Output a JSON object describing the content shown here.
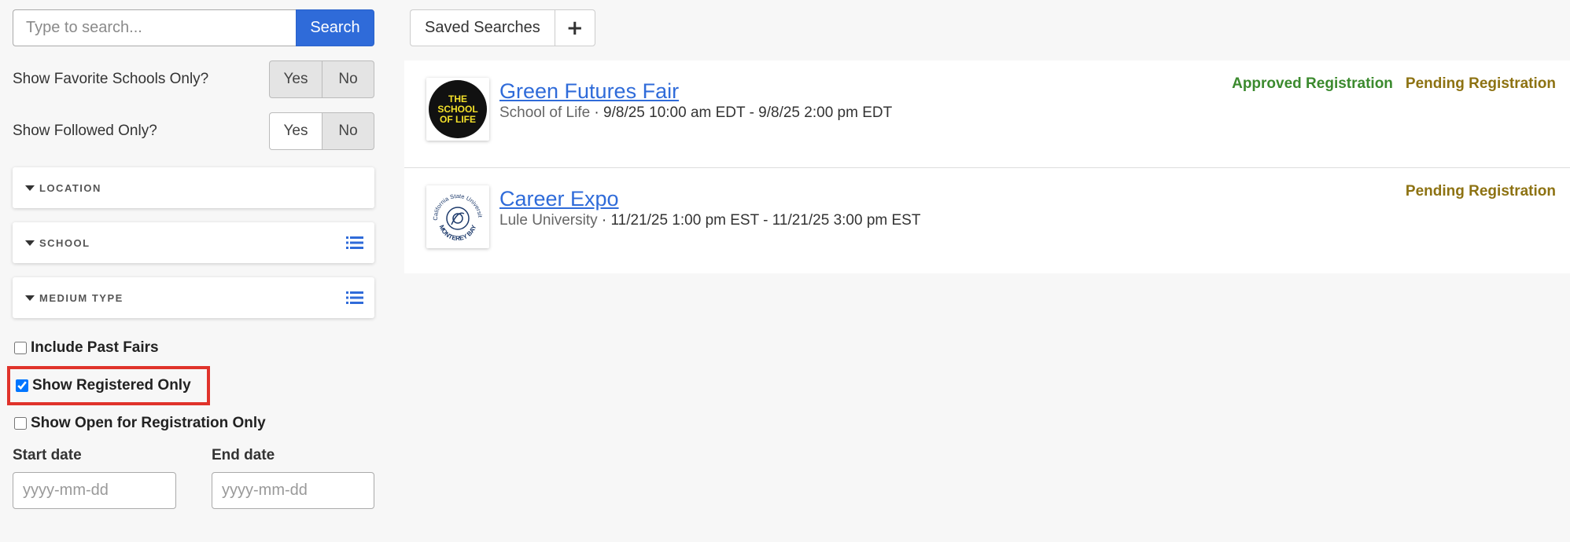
{
  "search": {
    "placeholder": "Type to search...",
    "button_label": "Search"
  },
  "filters": {
    "favorite_schools": {
      "label": "Show Favorite Schools Only?",
      "yes": "Yes",
      "no": "No",
      "selected": "No"
    },
    "followed": {
      "label": "Show Followed Only?",
      "yes": "Yes",
      "no": "No",
      "selected": "No"
    },
    "facets": [
      {
        "label": "LOCATION",
        "has_list_icon": false
      },
      {
        "label": "SCHOOL",
        "has_list_icon": true
      },
      {
        "label": "MEDIUM TYPE",
        "has_list_icon": true
      }
    ],
    "checkboxes": [
      {
        "label": "Include Past Fairs",
        "checked": false
      },
      {
        "label": "Show Registered Only",
        "checked": true
      },
      {
        "label": "Show Open for Registration Only",
        "checked": false
      }
    ],
    "start_date": {
      "label": "Start date",
      "placeholder": "yyyy-mm-dd"
    },
    "end_date": {
      "label": "End date",
      "placeholder": "yyyy-mm-dd"
    }
  },
  "saved_searches": {
    "label": "Saved Searches",
    "add_label": "+"
  },
  "results": [
    {
      "title": "Green Futures Fair",
      "school": "School of Life",
      "separator": " · ",
      "dates": "9/8/25 10:00 am EDT - 9/8/25 2:00 pm EDT",
      "logo_text": [
        "THE",
        "SCHOOL",
        "OF LIFE"
      ],
      "badges": [
        "Approved Registration",
        "Pending Registration"
      ]
    },
    {
      "title": "Career Expo",
      "school": "Lule University",
      "separator": " · ",
      "dates": "11/21/25 1:00 pm EST - 11/21/25 3:00 pm EST",
      "logo_text": [
        "California State University",
        "MONTEREY BAY"
      ],
      "badges": [
        "Pending Registration"
      ]
    }
  ],
  "colors": {
    "accent": "#2f6bd9",
    "approved": "#3b8a2e",
    "pending": "#8d7212",
    "highlight": "#e0332b"
  }
}
